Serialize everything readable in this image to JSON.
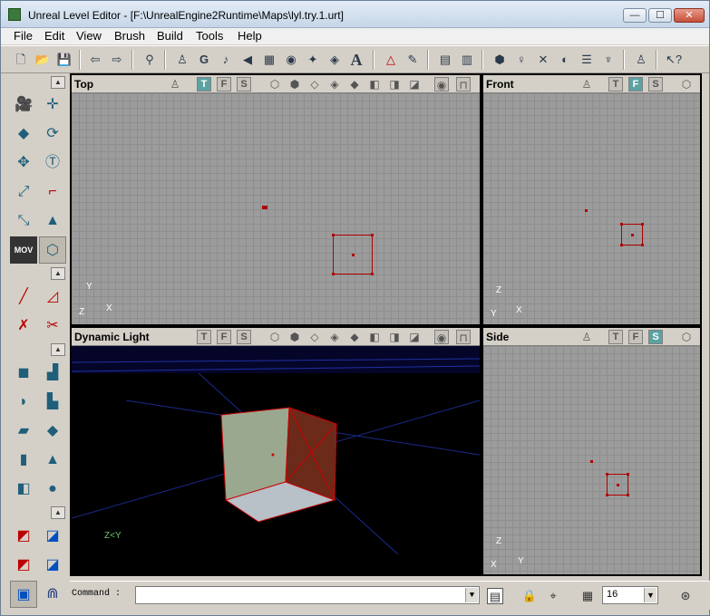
{
  "window": {
    "title": "Unreal Level Editor - [F:\\UnrealEngine2Runtime\\Maps\\lyl.try.1.urt]",
    "min": "—",
    "max": "☐",
    "close": "✕"
  },
  "menu": [
    "File",
    "Edit",
    "View",
    "Brush",
    "Build",
    "Tools",
    "Help"
  ],
  "toolbar_icons": [
    "new-icon",
    "open-icon",
    "save-icon",
    "undo-icon",
    "redo-icon",
    "search-icon",
    "actor-icon",
    "group-icon",
    "sound-icon",
    "texture-icon",
    "mesh-icon",
    "animation-icon",
    "static-mesh-icon",
    "font-icon",
    "build-geometry-icon",
    "build-lighting-icon",
    "build-paths-icon",
    "build-options-icon",
    "play-icon",
    "help-icon"
  ],
  "viewports": {
    "top": {
      "label": "Top",
      "t": "T",
      "f": "F",
      "s": "S",
      "axis_y": "Y",
      "axis_x": "X",
      "axis_z": "Z"
    },
    "front": {
      "label": "Front",
      "t": "T",
      "f": "F",
      "s": "S",
      "axis_z": "Z",
      "axis_y": "Y",
      "axis_x": "X"
    },
    "persp": {
      "label": "Dynamic Light",
      "t": "T",
      "f": "F",
      "s": "S",
      "axis": "Z<Y"
    },
    "side": {
      "label": "Side",
      "t": "T",
      "f": "F",
      "s": "S",
      "axis_z": "Z",
      "axis_x": "X",
      "axis_y": "Y"
    }
  },
  "status": {
    "command_label": "Command :",
    "command_value": "",
    "grid_size": "16"
  },
  "left_tools": {
    "mov_label": "MOV"
  }
}
